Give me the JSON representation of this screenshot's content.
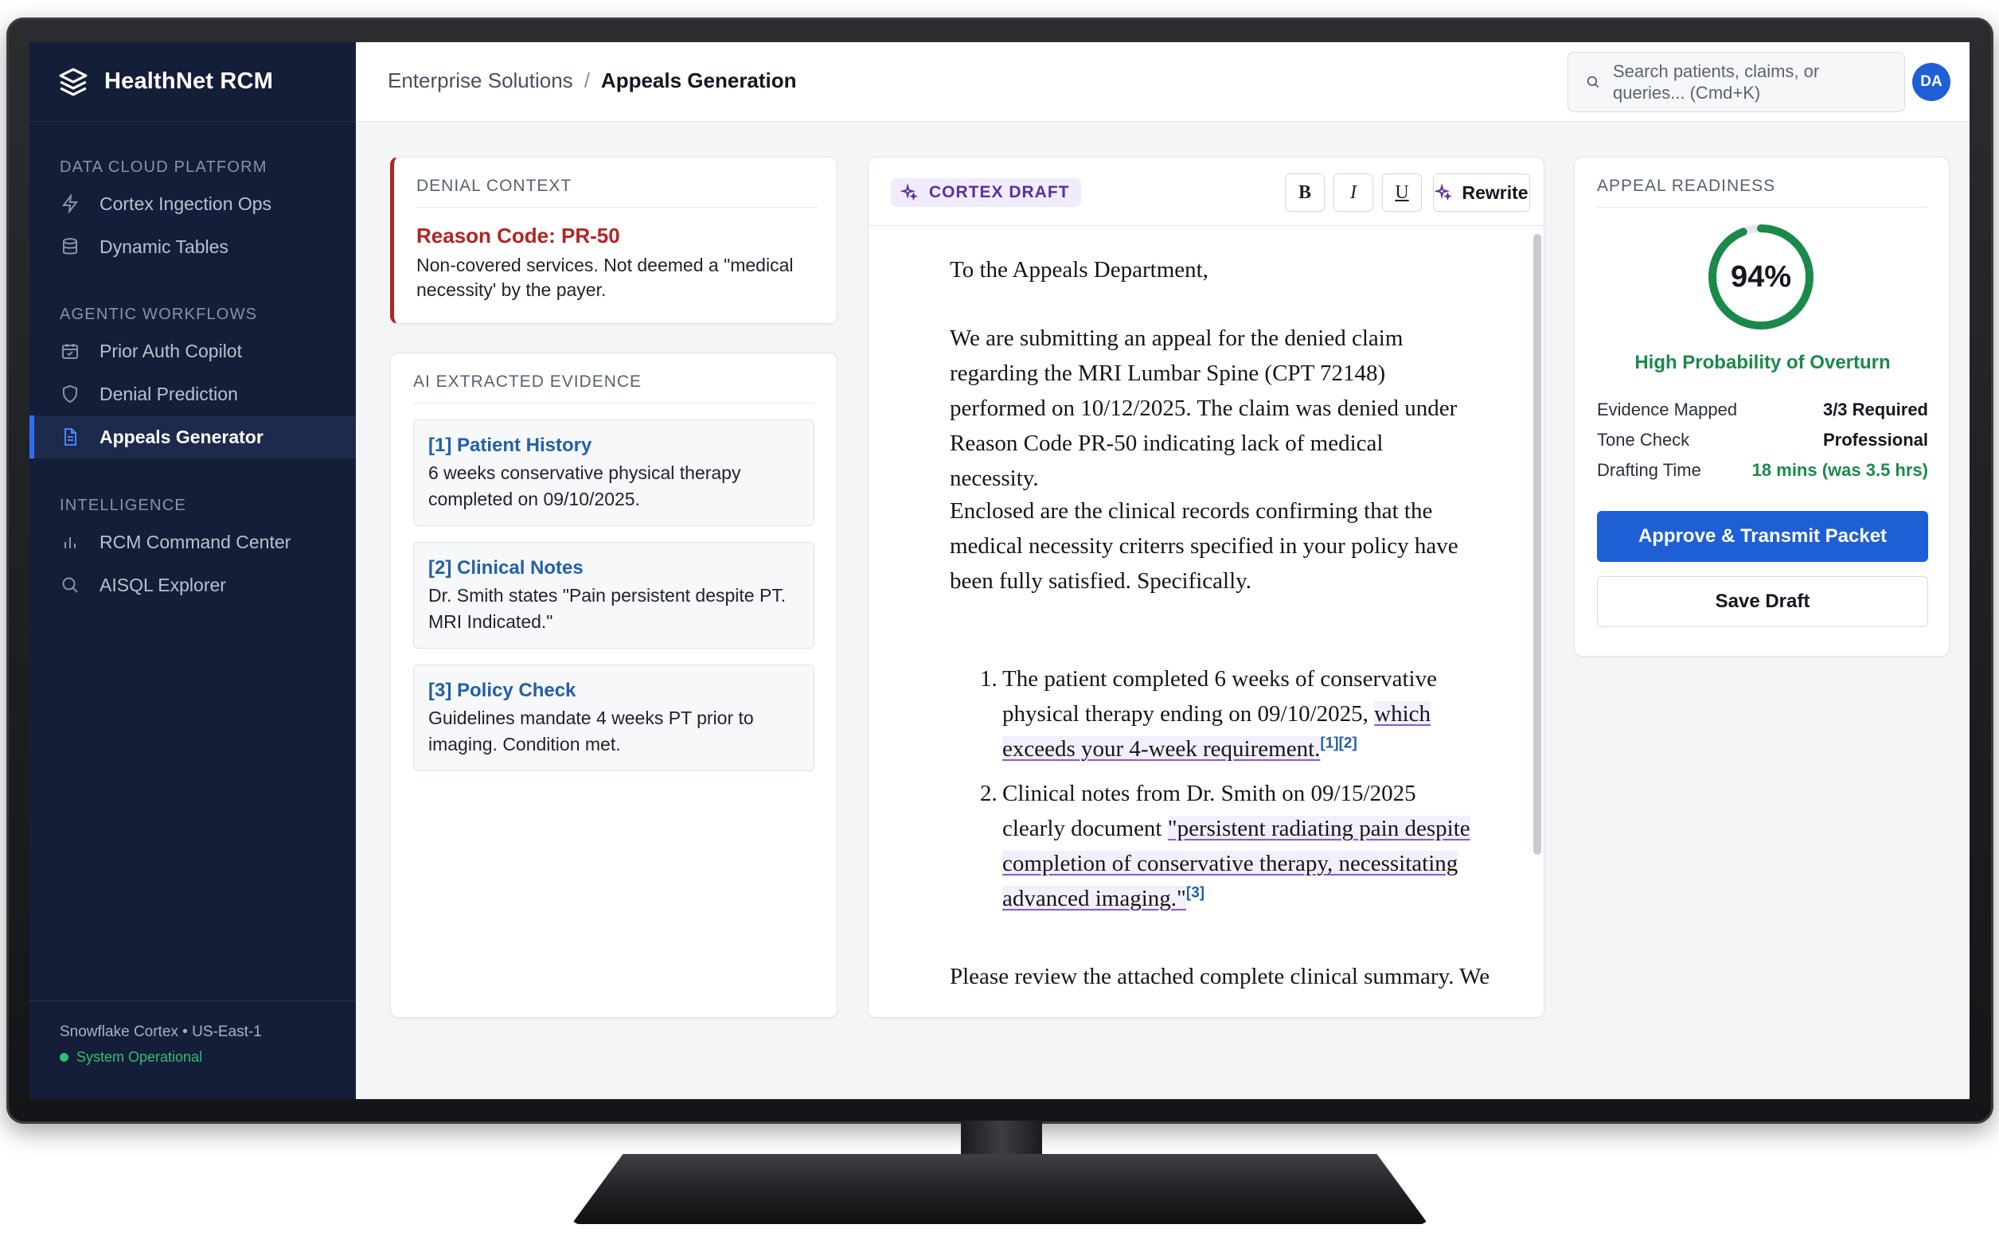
{
  "app": {
    "name": "HealthNet RCM"
  },
  "sidebar": {
    "sections": [
      {
        "title": "DATA CLOUD PLATFORM",
        "items": [
          {
            "label": "Cortex Ingection Ops",
            "icon": "bolt-icon"
          },
          {
            "label": "Dynamic Tables",
            "icon": "database-icon"
          }
        ]
      },
      {
        "title": "AGENTIC WORKFLOWS",
        "items": [
          {
            "label": "Prior Auth Copilot",
            "icon": "calendar-check-icon"
          },
          {
            "label": "Denial Prediction",
            "icon": "shield-icon"
          },
          {
            "label": "Appeals Generator",
            "icon": "document-icon",
            "active": true
          }
        ]
      },
      {
        "title": "INTELLIGENCE",
        "items": [
          {
            "label": "RCM Command Center",
            "icon": "bar-chart-icon"
          },
          {
            "label": "AISQL Explorer",
            "icon": "search-icon"
          }
        ]
      }
    ],
    "footer": {
      "region": "Snowflake Cortex • US-East-1",
      "status": "System Operational"
    }
  },
  "header": {
    "breadcrumb": {
      "parent": "Enterprise Solutions",
      "separator": "/",
      "current": "Appeals Generation"
    },
    "search": {
      "placeholder": "Search patients, claims, or queries... (Cmd+K)"
    },
    "avatar": "DA"
  },
  "denial": {
    "title": "DENIAL CONTEXT",
    "reason_code": "Reason Code: PR-50",
    "description": "Non-covered services. Not deemed a \"medical necessity' by the payer."
  },
  "evidence": {
    "title": "AI EXTRACTED EVIDENCE",
    "items": [
      {
        "heading": "[1] Patient History",
        "body": "6 weeks conservative physical therapy completed on 09/10/2025."
      },
      {
        "heading": "[2] Clinical Notes",
        "body": "Dr. Smith states \"Pain persistent despite PT. MRI Indicated.\""
      },
      {
        "heading": "[3] Policy Check",
        "body": "Guidelines mandate 4 weeks PT prior to imaging. Condition met."
      }
    ]
  },
  "draft": {
    "chip": "CORTEX DRAFT",
    "format_buttons": {
      "bold": "B",
      "italic": "I",
      "underline": "U"
    },
    "rewrite": "Rewrite",
    "salutation": "To the Appeals Department,",
    "para1": "We are submitting an appeal for the denied claim regarding the MRI Lumbar Spine (CPT 72148) performed on 10/12/2025. The claim was denied under Reason Code PR-50 indicating lack of medical necessity.",
    "para2": "Enclosed are the clinical records confirming that the medical necessity criterrs specified in your policy have been fully satisfied. Specifically.",
    "list": [
      {
        "num": "1.",
        "plain": "The patient completed 6 weeks of conservative physical therapy ending on 09/10/2025, ",
        "highlight": "which exceeds your 4-week requirement.",
        "cite": "[1][2]"
      },
      {
        "num": "2.",
        "plain": "Clinical notes from Dr. Smith on 09/15/2025 clearly document ",
        "highlight": "\"persistent radiating pain despite completion of conservative therapy, necessitating advanced imaging.\"",
        "cite": "[3]"
      }
    ],
    "closing": "Please review the attached complete clinical summary. We"
  },
  "readiness": {
    "title": "APPEAL READINESS",
    "score": 94,
    "score_label": "94%",
    "probability": "High Probability of Overturn",
    "metrics": [
      {
        "key": "Evidence Mapped",
        "value": "3/3 Required"
      },
      {
        "key": "Tone Check",
        "value": "Professional"
      },
      {
        "key": "Drafting Time",
        "value": "18 mins (was 3.5 hrs)",
        "accent": "green"
      }
    ],
    "approve": "Approve & Transmit Packet",
    "save": "Save Draft"
  },
  "colors": {
    "sidebar_bg": "#141e38",
    "accent_blue": "#1f5fd6",
    "denial_red": "#b22424",
    "success_green": "#1a8a4a",
    "draft_purple": "#5b2fa3"
  }
}
